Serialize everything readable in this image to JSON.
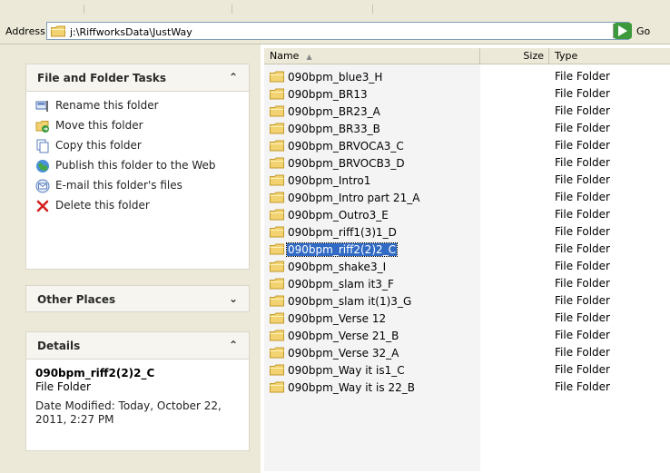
{
  "address": {
    "label": "Address",
    "path": "j:\\RiffworksData\\JustWay",
    "go_label": "Go"
  },
  "left": {
    "tasks_panel": {
      "title": "File and Folder Tasks",
      "chevron": "ˆ",
      "items": [
        {
          "label": "Rename this folder",
          "icon": "rename-icon"
        },
        {
          "label": "Move this folder",
          "icon": "move-icon"
        },
        {
          "label": "Copy this folder",
          "icon": "copy-icon"
        },
        {
          "label": "Publish this folder to the Web",
          "icon": "publish-icon"
        },
        {
          "label": "E-mail this folder's files",
          "icon": "email-icon"
        },
        {
          "label": "Delete this folder",
          "icon": "delete-icon"
        }
      ]
    },
    "other_places": {
      "title": "Other Places"
    },
    "details": {
      "title": "Details",
      "name": "090bpm_riff2(2)2_C",
      "type": "File Folder",
      "date": "Date Modified: Today, October 22, 2011, 2:27 PM"
    }
  },
  "list": {
    "columns": {
      "name": "Name",
      "size": "Size",
      "type": "Type"
    },
    "rows": [
      {
        "name": "090bpm_blue3_H",
        "type": "File Folder"
      },
      {
        "name": "090bpm_BR13",
        "type": "File Folder"
      },
      {
        "name": "090bpm_BR23_A",
        "type": "File Folder"
      },
      {
        "name": "090bpm_BR33_B",
        "type": "File Folder"
      },
      {
        "name": "090bpm_BRVOCA3_C",
        "type": "File Folder"
      },
      {
        "name": "090bpm_BRVOCB3_D",
        "type": "File Folder"
      },
      {
        "name": "090bpm_Intro1",
        "type": "File Folder"
      },
      {
        "name": "090bpm_Intro part 21_A",
        "type": "File Folder"
      },
      {
        "name": "090bpm_Outro3_E",
        "type": "File Folder"
      },
      {
        "name": "090bpm_riff1(3)1_D",
        "type": "File Folder"
      },
      {
        "name": "090bpm_riff2(2)2_C",
        "type": "File Folder",
        "selected": true
      },
      {
        "name": "090bpm_shake3_I",
        "type": "File Folder"
      },
      {
        "name": "090bpm_slam it3_F",
        "type": "File Folder"
      },
      {
        "name": "090bpm_slam it(1)3_G",
        "type": "File Folder"
      },
      {
        "name": "090bpm_Verse 12",
        "type": "File Folder"
      },
      {
        "name": "090bpm_Verse 21_B",
        "type": "File Folder"
      },
      {
        "name": "090bpm_Verse 32_A",
        "type": "File Folder"
      },
      {
        "name": "090bpm_Way it is1_C",
        "type": "File Folder"
      },
      {
        "name": "090bpm_Way it is 22_B",
        "type": "File Folder"
      }
    ]
  }
}
